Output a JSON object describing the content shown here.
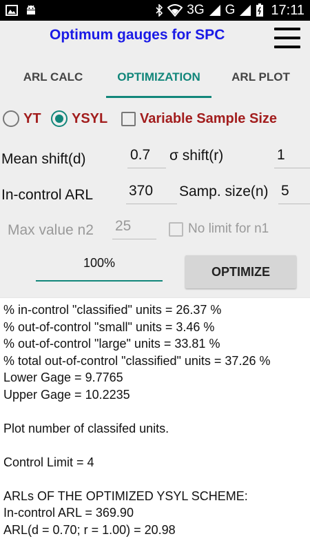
{
  "status_bar": {
    "left_icons": [
      "image-icon",
      "android-icon"
    ],
    "right_icons": [
      "bluetooth-icon",
      "wifi-icon",
      "signal-icon",
      "signal-icon",
      "battery-icon"
    ],
    "network_3g": "3G",
    "network_g": "G",
    "time": "17:11"
  },
  "app_bar": {
    "title": "Optimum gauges for SPC",
    "title_color": "#1a1ae6",
    "menu_icon": "hamburger-menu-icon"
  },
  "tabs": [
    {
      "label": "ARL CALC",
      "active": false
    },
    {
      "label": "OPTIMIZATION",
      "active": true
    },
    {
      "label": "ARL PLOT",
      "active": false
    }
  ],
  "accent_color": "#11867a",
  "options": {
    "yt_label": "YT",
    "yt_checked": false,
    "ysyl_label": "YSYL",
    "ysyl_checked": true,
    "variable_sample_label": "Variable Sample Size",
    "variable_sample_checked": false
  },
  "params": {
    "mean_shift_label": "Mean shift(d)",
    "mean_shift_value": "0.7",
    "sigma_shift_label": "σ shift(r)",
    "sigma_shift_value": "1",
    "in_control_arl_label": "In-control ARL",
    "in_control_arl_value": "370",
    "samp_size_label": "Samp. size(n)",
    "samp_size_value": "5",
    "max_n2_label": "Max value n2",
    "max_n2_value": "25",
    "no_limit_label": "No limit for n1",
    "no_limit_checked": false
  },
  "percent_value": "100%",
  "optimize_button": "OPTIMIZE",
  "results": [
    "% in-control \"classified\" units = 26.37 %",
    "% out-of-control \"small\" units = 3.46 %",
    "% out-of-control \"large\" units = 33.81 %",
    "% total out-of-control \"classified\" units = 37.26 %",
    "Lower Gage = 9.7765",
    "Upper Gage = 10.2235",
    "",
    "Plot number of classifed units.",
    "",
    "Control Limit  = 4",
    "",
    "ARLs OF THE OPTIMIZED YSYL SCHEME:",
    "In-control ARL = 369.90",
    "ARL(d = 0.70; r = 1.00) = 20.98"
  ]
}
